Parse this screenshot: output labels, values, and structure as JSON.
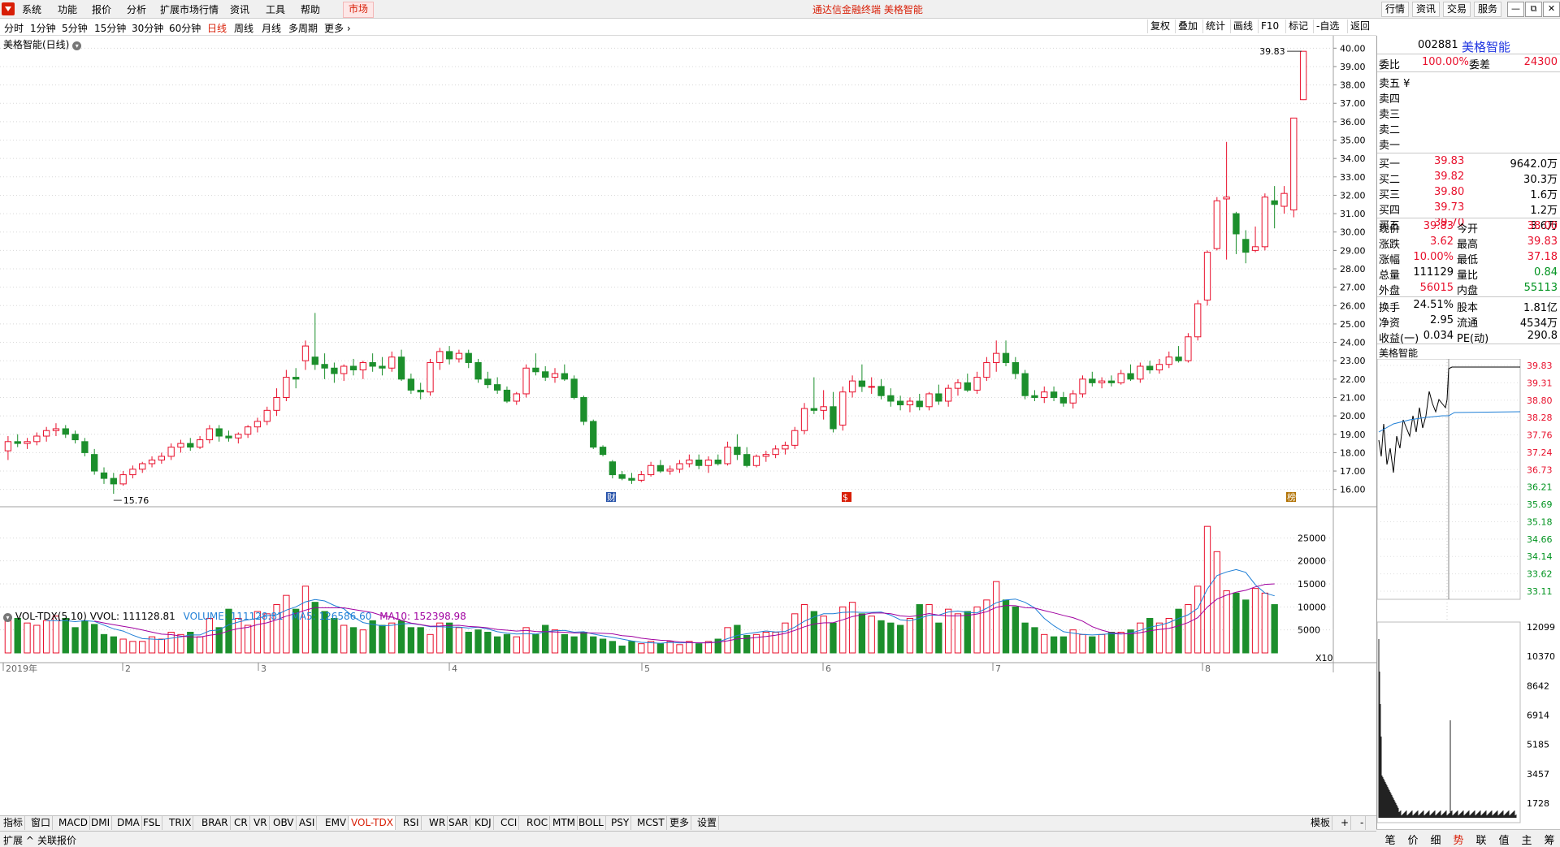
{
  "menu": {
    "items": [
      "系统",
      "功能",
      "报价",
      "分析",
      "扩展市场行情",
      "资讯",
      "工具",
      "帮助"
    ],
    "market": "市场",
    "center_title": "通达信金融终端  美格智能",
    "right_buttons": [
      "行情",
      "资讯",
      "交易",
      "服务"
    ],
    "win_buttons": [
      "—",
      "⧉",
      "—",
      "⧉",
      "✕"
    ]
  },
  "periods": {
    "items": [
      "分时",
      "1分钟",
      "5分钟",
      "15分钟",
      "30分钟",
      "60分钟",
      "日线",
      "周线",
      "月线",
      "多周期",
      "更多"
    ],
    "active": "日线",
    "tools": [
      "复权",
      "叠加",
      "统计",
      "画线",
      "F10",
      "标记",
      "-自选",
      "返回"
    ]
  },
  "chart": {
    "title": "美格智能(日线)",
    "high_label": "39.83",
    "low_label": "15.76",
    "price_axis": [
      "40.00",
      "39.00",
      "38.00",
      "37.00",
      "36.00",
      "35.00",
      "34.00",
      "33.00",
      "32.00",
      "31.00",
      "30.00",
      "29.00",
      "28.00",
      "27.00",
      "26.00",
      "25.00",
      "24.00",
      "23.00",
      "22.00",
      "21.00",
      "20.00",
      "19.00",
      "18.00",
      "17.00",
      "16.00"
    ],
    "x_labels": [
      "2019年",
      "2",
      "3",
      "4",
      "5",
      "6",
      "7",
      "8"
    ],
    "markers": [
      "财",
      "$",
      "榜"
    ],
    "colors": {
      "up": "#e8102c",
      "down": "#1c8f2c",
      "ma5": "#1f7fd6",
      "ma10": "#a000a0",
      "grid": "#d8d8d8"
    }
  },
  "chart_data": {
    "type": "candlestick",
    "ohlc": [
      [
        18.1,
        18.9,
        17.6,
        18.6
      ],
      [
        18.6,
        19.0,
        18.3,
        18.5
      ],
      [
        18.5,
        18.8,
        18.2,
        18.6
      ],
      [
        18.6,
        19.1,
        18.4,
        18.9
      ],
      [
        18.9,
        19.4,
        18.6,
        19.2
      ],
      [
        19.2,
        19.6,
        18.9,
        19.3
      ],
      [
        19.3,
        19.5,
        18.8,
        19.0
      ],
      [
        19.0,
        19.2,
        18.5,
        18.7
      ],
      [
        18.6,
        18.8,
        17.8,
        18.0
      ],
      [
        17.9,
        18.2,
        16.8,
        17.0
      ],
      [
        16.9,
        17.2,
        16.3,
        16.6
      ],
      [
        16.6,
        16.9,
        15.76,
        16.3
      ],
      [
        16.3,
        17.0,
        16.2,
        16.8
      ],
      [
        16.8,
        17.3,
        16.6,
        17.1
      ],
      [
        17.1,
        17.5,
        16.9,
        17.4
      ],
      [
        17.4,
        17.8,
        17.2,
        17.6
      ],
      [
        17.6,
        18.0,
        17.4,
        17.8
      ],
      [
        17.8,
        18.5,
        17.6,
        18.3
      ],
      [
        18.3,
        18.7,
        18.0,
        18.5
      ],
      [
        18.5,
        18.8,
        18.1,
        18.3
      ],
      [
        18.3,
        18.9,
        18.2,
        18.7
      ],
      [
        18.7,
        19.5,
        18.5,
        19.3
      ],
      [
        19.3,
        19.5,
        18.6,
        18.9
      ],
      [
        18.9,
        19.2,
        18.6,
        18.8
      ],
      [
        18.8,
        19.1,
        18.5,
        19.0
      ],
      [
        19.0,
        19.5,
        18.8,
        19.4
      ],
      [
        19.4,
        19.9,
        19.1,
        19.7
      ],
      [
        19.7,
        20.5,
        19.5,
        20.3
      ],
      [
        20.3,
        21.5,
        20.0,
        21.0
      ],
      [
        21.0,
        22.5,
        20.8,
        22.1
      ],
      [
        22.1,
        22.6,
        21.5,
        22.0
      ],
      [
        23.0,
        24.1,
        22.5,
        23.8
      ],
      [
        23.2,
        25.6,
        22.5,
        22.8
      ],
      [
        22.8,
        23.4,
        22.0,
        22.6
      ],
      [
        22.6,
        22.9,
        21.8,
        22.3
      ],
      [
        22.3,
        22.8,
        21.9,
        22.7
      ],
      [
        22.7,
        23.1,
        22.2,
        22.5
      ],
      [
        22.5,
        23.0,
        22.0,
        22.9
      ],
      [
        22.9,
        23.4,
        22.4,
        22.7
      ],
      [
        22.7,
        23.2,
        22.2,
        22.6
      ],
      [
        22.6,
        23.5,
        22.4,
        23.2
      ],
      [
        23.2,
        23.6,
        21.9,
        22.0
      ],
      [
        22.0,
        22.3,
        21.2,
        21.4
      ],
      [
        21.4,
        21.8,
        20.9,
        21.3
      ],
      [
        21.3,
        23.1,
        21.1,
        22.9
      ],
      [
        22.9,
        23.7,
        22.5,
        23.5
      ],
      [
        23.5,
        23.8,
        22.8,
        23.1
      ],
      [
        23.1,
        23.6,
        22.9,
        23.4
      ],
      [
        23.4,
        23.6,
        22.6,
        22.9
      ],
      [
        22.9,
        23.1,
        21.8,
        22.0
      ],
      [
        22.0,
        22.4,
        21.5,
        21.7
      ],
      [
        21.7,
        22.1,
        21.2,
        21.4
      ],
      [
        21.4,
        21.6,
        20.7,
        20.8
      ],
      [
        20.8,
        21.3,
        20.6,
        21.2
      ],
      [
        21.2,
        22.8,
        21.0,
        22.6
      ],
      [
        22.6,
        23.4,
        22.2,
        22.4
      ],
      [
        22.4,
        22.7,
        21.9,
        22.1
      ],
      [
        22.1,
        22.6,
        21.8,
        22.3
      ],
      [
        22.3,
        22.8,
        21.9,
        22.0
      ],
      [
        22.0,
        22.2,
        20.9,
        21.0
      ],
      [
        21.0,
        21.1,
        19.5,
        19.7
      ],
      [
        19.7,
        19.8,
        18.2,
        18.3
      ],
      [
        18.3,
        18.4,
        17.8,
        17.9
      ],
      [
        17.5,
        17.6,
        16.6,
        16.8
      ],
      [
        16.8,
        17.0,
        16.5,
        16.6
      ],
      [
        16.6,
        16.9,
        16.3,
        16.5
      ],
      [
        16.5,
        17.0,
        16.4,
        16.8
      ],
      [
        16.8,
        17.5,
        16.7,
        17.3
      ],
      [
        17.3,
        17.6,
        16.9,
        17.0
      ],
      [
        17.0,
        17.3,
        16.8,
        17.1
      ],
      [
        17.1,
        17.6,
        16.9,
        17.4
      ],
      [
        17.4,
        17.9,
        17.2,
        17.6
      ],
      [
        17.6,
        17.9,
        17.1,
        17.3
      ],
      [
        17.3,
        17.8,
        16.9,
        17.6
      ],
      [
        17.6,
        17.9,
        17.3,
        17.4
      ],
      [
        17.4,
        18.6,
        17.3,
        18.3
      ],
      [
        18.3,
        19.0,
        17.6,
        17.9
      ],
      [
        17.9,
        18.3,
        17.2,
        17.3
      ],
      [
        17.3,
        17.9,
        17.2,
        17.8
      ],
      [
        17.8,
        18.1,
        17.5,
        17.9
      ],
      [
        17.9,
        18.4,
        17.7,
        18.2
      ],
      [
        18.2,
        18.6,
        17.9,
        18.4
      ],
      [
        18.4,
        19.4,
        18.2,
        19.2
      ],
      [
        19.2,
        20.7,
        19.0,
        20.4
      ],
      [
        20.4,
        22.1,
        20.1,
        20.3
      ],
      [
        20.3,
        21.4,
        19.8,
        20.5
      ],
      [
        20.5,
        21.3,
        19.1,
        19.3
      ],
      [
        19.5,
        21.6,
        19.2,
        21.3
      ],
      [
        21.3,
        22.2,
        21.0,
        21.9
      ],
      [
        21.9,
        22.8,
        21.3,
        21.6
      ],
      [
        21.6,
        22.1,
        21.2,
        21.6
      ],
      [
        21.6,
        22.0,
        20.9,
        21.1
      ],
      [
        21.1,
        21.5,
        20.5,
        20.8
      ],
      [
        20.8,
        21.1,
        20.3,
        20.6
      ],
      [
        20.6,
        21.0,
        20.2,
        20.8
      ],
      [
        20.8,
        21.2,
        20.3,
        20.5
      ],
      [
        20.5,
        21.3,
        20.3,
        21.2
      ],
      [
        21.2,
        21.7,
        20.6,
        20.8
      ],
      [
        20.8,
        21.7,
        20.5,
        21.5
      ],
      [
        21.5,
        22.0,
        21.1,
        21.8
      ],
      [
        21.8,
        22.3,
        21.3,
        21.4
      ],
      [
        21.4,
        22.4,
        21.2,
        22.1
      ],
      [
        22.1,
        23.2,
        21.9,
        22.9
      ],
      [
        22.9,
        24.1,
        22.4,
        23.4
      ],
      [
        23.4,
        24.1,
        22.7,
        22.9
      ],
      [
        22.9,
        23.2,
        22.0,
        22.3
      ],
      [
        22.3,
        22.5,
        20.9,
        21.1
      ],
      [
        21.1,
        21.4,
        20.8,
        21.0
      ],
      [
        21.0,
        21.6,
        20.7,
        21.3
      ],
      [
        21.3,
        21.6,
        20.8,
        21.0
      ],
      [
        21.0,
        21.3,
        20.5,
        20.7
      ],
      [
        20.7,
        21.4,
        20.4,
        21.2
      ],
      [
        21.2,
        22.2,
        21.0,
        22.0
      ],
      [
        22.0,
        22.4,
        21.6,
        21.8
      ],
      [
        21.8,
        22.1,
        21.5,
        21.9
      ],
      [
        21.9,
        22.2,
        21.6,
        21.8
      ],
      [
        21.8,
        22.5,
        21.7,
        22.3
      ],
      [
        22.3,
        22.8,
        21.9,
        22.0
      ],
      [
        22.0,
        22.9,
        21.8,
        22.7
      ],
      [
        22.7,
        23.0,
        22.3,
        22.5
      ],
      [
        22.5,
        23.1,
        22.3,
        22.8
      ],
      [
        22.8,
        23.5,
        22.6,
        23.2
      ],
      [
        23.2,
        23.8,
        22.9,
        23.0
      ],
      [
        23.0,
        24.5,
        22.9,
        24.3
      ],
      [
        24.3,
        26.3,
        24.1,
        26.1
      ],
      [
        26.3,
        29.0,
        26.0,
        28.9
      ],
      [
        29.1,
        31.9,
        29.0,
        31.7
      ],
      [
        31.8,
        34.9,
        28.5,
        31.9
      ],
      [
        31.0,
        31.1,
        28.8,
        29.9
      ],
      [
        29.6,
        30.1,
        28.3,
        28.9
      ],
      [
        29.0,
        30.3,
        28.9,
        29.2
      ],
      [
        29.2,
        32.1,
        29.0,
        31.9
      ],
      [
        31.7,
        32.5,
        30.2,
        31.5
      ],
      [
        31.4,
        32.5,
        31.0,
        32.1
      ],
      [
        31.2,
        36.0,
        30.8,
        36.2
      ],
      [
        37.2,
        39.83,
        37.18,
        39.83
      ]
    ],
    "volume": [
      8000,
      7500,
      6500,
      6000,
      7000,
      8000,
      7500,
      5500,
      7000,
      6200,
      4000,
      3500,
      3000,
      2500,
      2500,
      3500,
      3000,
      4500,
      4000,
      4500,
      3500,
      7500,
      5500,
      9500,
      7500,
      6000,
      9000,
      8500,
      10500,
      12500,
      9500,
      14500,
      11000,
      9000,
      7500,
      6000,
      5500,
      5000,
      7000,
      6000,
      6500,
      7000,
      5500,
      5500,
      4000,
      6500,
      6500,
      5500,
      4500,
      5000,
      4500,
      3500,
      4000,
      3500,
      5500,
      4000,
      6000,
      5000,
      4000,
      3500,
      4500,
      3500,
      3000,
      2500,
      1500,
      2500,
      2000,
      2500,
      2000,
      2500,
      1800,
      2500,
      2000,
      2500,
      3000,
      5500,
      6000,
      3800,
      4000,
      4500,
      4500,
      6500,
      8500,
      10500,
      9000,
      8000,
      6500,
      10000,
      11000,
      8500,
      8000,
      7000,
      6500,
      6000,
      7500,
      10500,
      10500,
      6500,
      9500,
      8500,
      9000,
      10000,
      11500,
      15500,
      11500,
      10000,
      6500,
      5500,
      4000,
      3500,
      3500,
      5000,
      4000,
      3500,
      4000,
      4500,
      4500,
      5000,
      6500,
      7500,
      6500,
      7500,
      9500,
      10500,
      14500,
      27500,
      22000,
      13500,
      13000,
      11500,
      14000,
      13000,
      10500
    ],
    "ma5_label": "MA5",
    "ma10_label": "MA10",
    "y_range": [
      15.5,
      40.5
    ],
    "vol_axis": [
      "25000",
      "20000",
      "15000",
      "10000",
      "5000"
    ],
    "vol_multiplier": "X10"
  },
  "volume_header": {
    "name": "VOL-TDX(5,10)",
    "vvol": "VVOL: 111128.81",
    "volume": "VOLUME: 111128.81",
    "ma5": "MA5: 126586.60",
    "ma10": "MA10: 152398.98"
  },
  "quote": {
    "code": "002881",
    "name": "美格智能",
    "weibi_label": "委比",
    "weibi": "100.00%",
    "weicha_label": "委差",
    "weicha": "24300",
    "sells": [
      {
        "label": "卖五 ¥",
        "price": "",
        "vol": ""
      },
      {
        "label": "卖四",
        "price": "",
        "vol": ""
      },
      {
        "label": "卖三",
        "price": "",
        "vol": ""
      },
      {
        "label": "卖二",
        "price": "",
        "vol": ""
      },
      {
        "label": "卖一",
        "price": "",
        "vol": ""
      }
    ],
    "buys": [
      {
        "label": "买一",
        "price": "39.83",
        "vol": "9642.0万"
      },
      {
        "label": "买二",
        "price": "39.82",
        "vol": "30.3万"
      },
      {
        "label": "买三",
        "price": "39.80",
        "vol": "1.6万"
      },
      {
        "label": "买四",
        "price": "39.73",
        "vol": "1.2万"
      },
      {
        "label": "买五",
        "price": "39.70",
        "vol": "3.6万"
      }
    ],
    "stats": [
      {
        "l1": "现价",
        "v1": "39.83",
        "c1": "red",
        "l2": "今开",
        "v2": "38.00",
        "c2": "red"
      },
      {
        "l1": "涨跌",
        "v1": "3.62",
        "c1": "red",
        "l2": "最高",
        "v2": "39.83",
        "c2": "red"
      },
      {
        "l1": "涨幅",
        "v1": "10.00%",
        "c1": "red",
        "l2": "最低",
        "v2": "37.18",
        "c2": "red"
      },
      {
        "l1": "总量",
        "v1": "111129",
        "c1": "black",
        "l2": "量比",
        "v2": "0.84",
        "c2": "green"
      },
      {
        "l1": "外盘",
        "v1": "56015",
        "c1": "red",
        "l2": "内盘",
        "v2": "55113",
        "c2": "green"
      },
      {
        "l1": "换手",
        "v1": "24.51%",
        "c1": "black",
        "l2": "股本",
        "v2": "1.81亿",
        "c2": "black"
      },
      {
        "l1": "净资",
        "v1": "2.95",
        "c1": "black",
        "l2": "流通",
        "v2": "4534万",
        "c2": "black"
      },
      {
        "l1": "收益(一)",
        "v1": "0.034",
        "c1": "black",
        "l2": "PE(动)",
        "v2": "290.8",
        "c2": "black"
      }
    ]
  },
  "mini": {
    "title": "美格智能",
    "price_axis": [
      "39.83",
      "39.31",
      "38.80",
      "38.28",
      "37.76",
      "37.24",
      "36.73",
      "36.21",
      "35.69",
      "35.18",
      "34.66",
      "34.14",
      "33.62",
      "33.11"
    ],
    "vol_axis": [
      "12099",
      "10370",
      "8642",
      "6914",
      "5185",
      "3457",
      "1728"
    ]
  },
  "tabs": {
    "items": [
      "指标",
      "窗口",
      "MACD",
      "DMI",
      "DMA",
      "FSL",
      "TRIX",
      "BRAR",
      "CR",
      "VR",
      "OBV",
      "ASI",
      "EMV",
      "VOL-TDX",
      "RSI",
      "WR",
      "SAR",
      "KDJ",
      "CCI",
      "ROC",
      "MTM",
      "BOLL",
      "PSY",
      "MCST",
      "更多",
      "设置"
    ],
    "active": "VOL-TDX",
    "right": [
      "模板",
      "+",
      "-"
    ]
  },
  "status": {
    "left": "扩展 ^",
    "item": "关联报价"
  },
  "rtabs": {
    "items": [
      "笔",
      "价",
      "细",
      "势",
      "联",
      "值",
      "主",
      "筹"
    ],
    "active": "势"
  }
}
